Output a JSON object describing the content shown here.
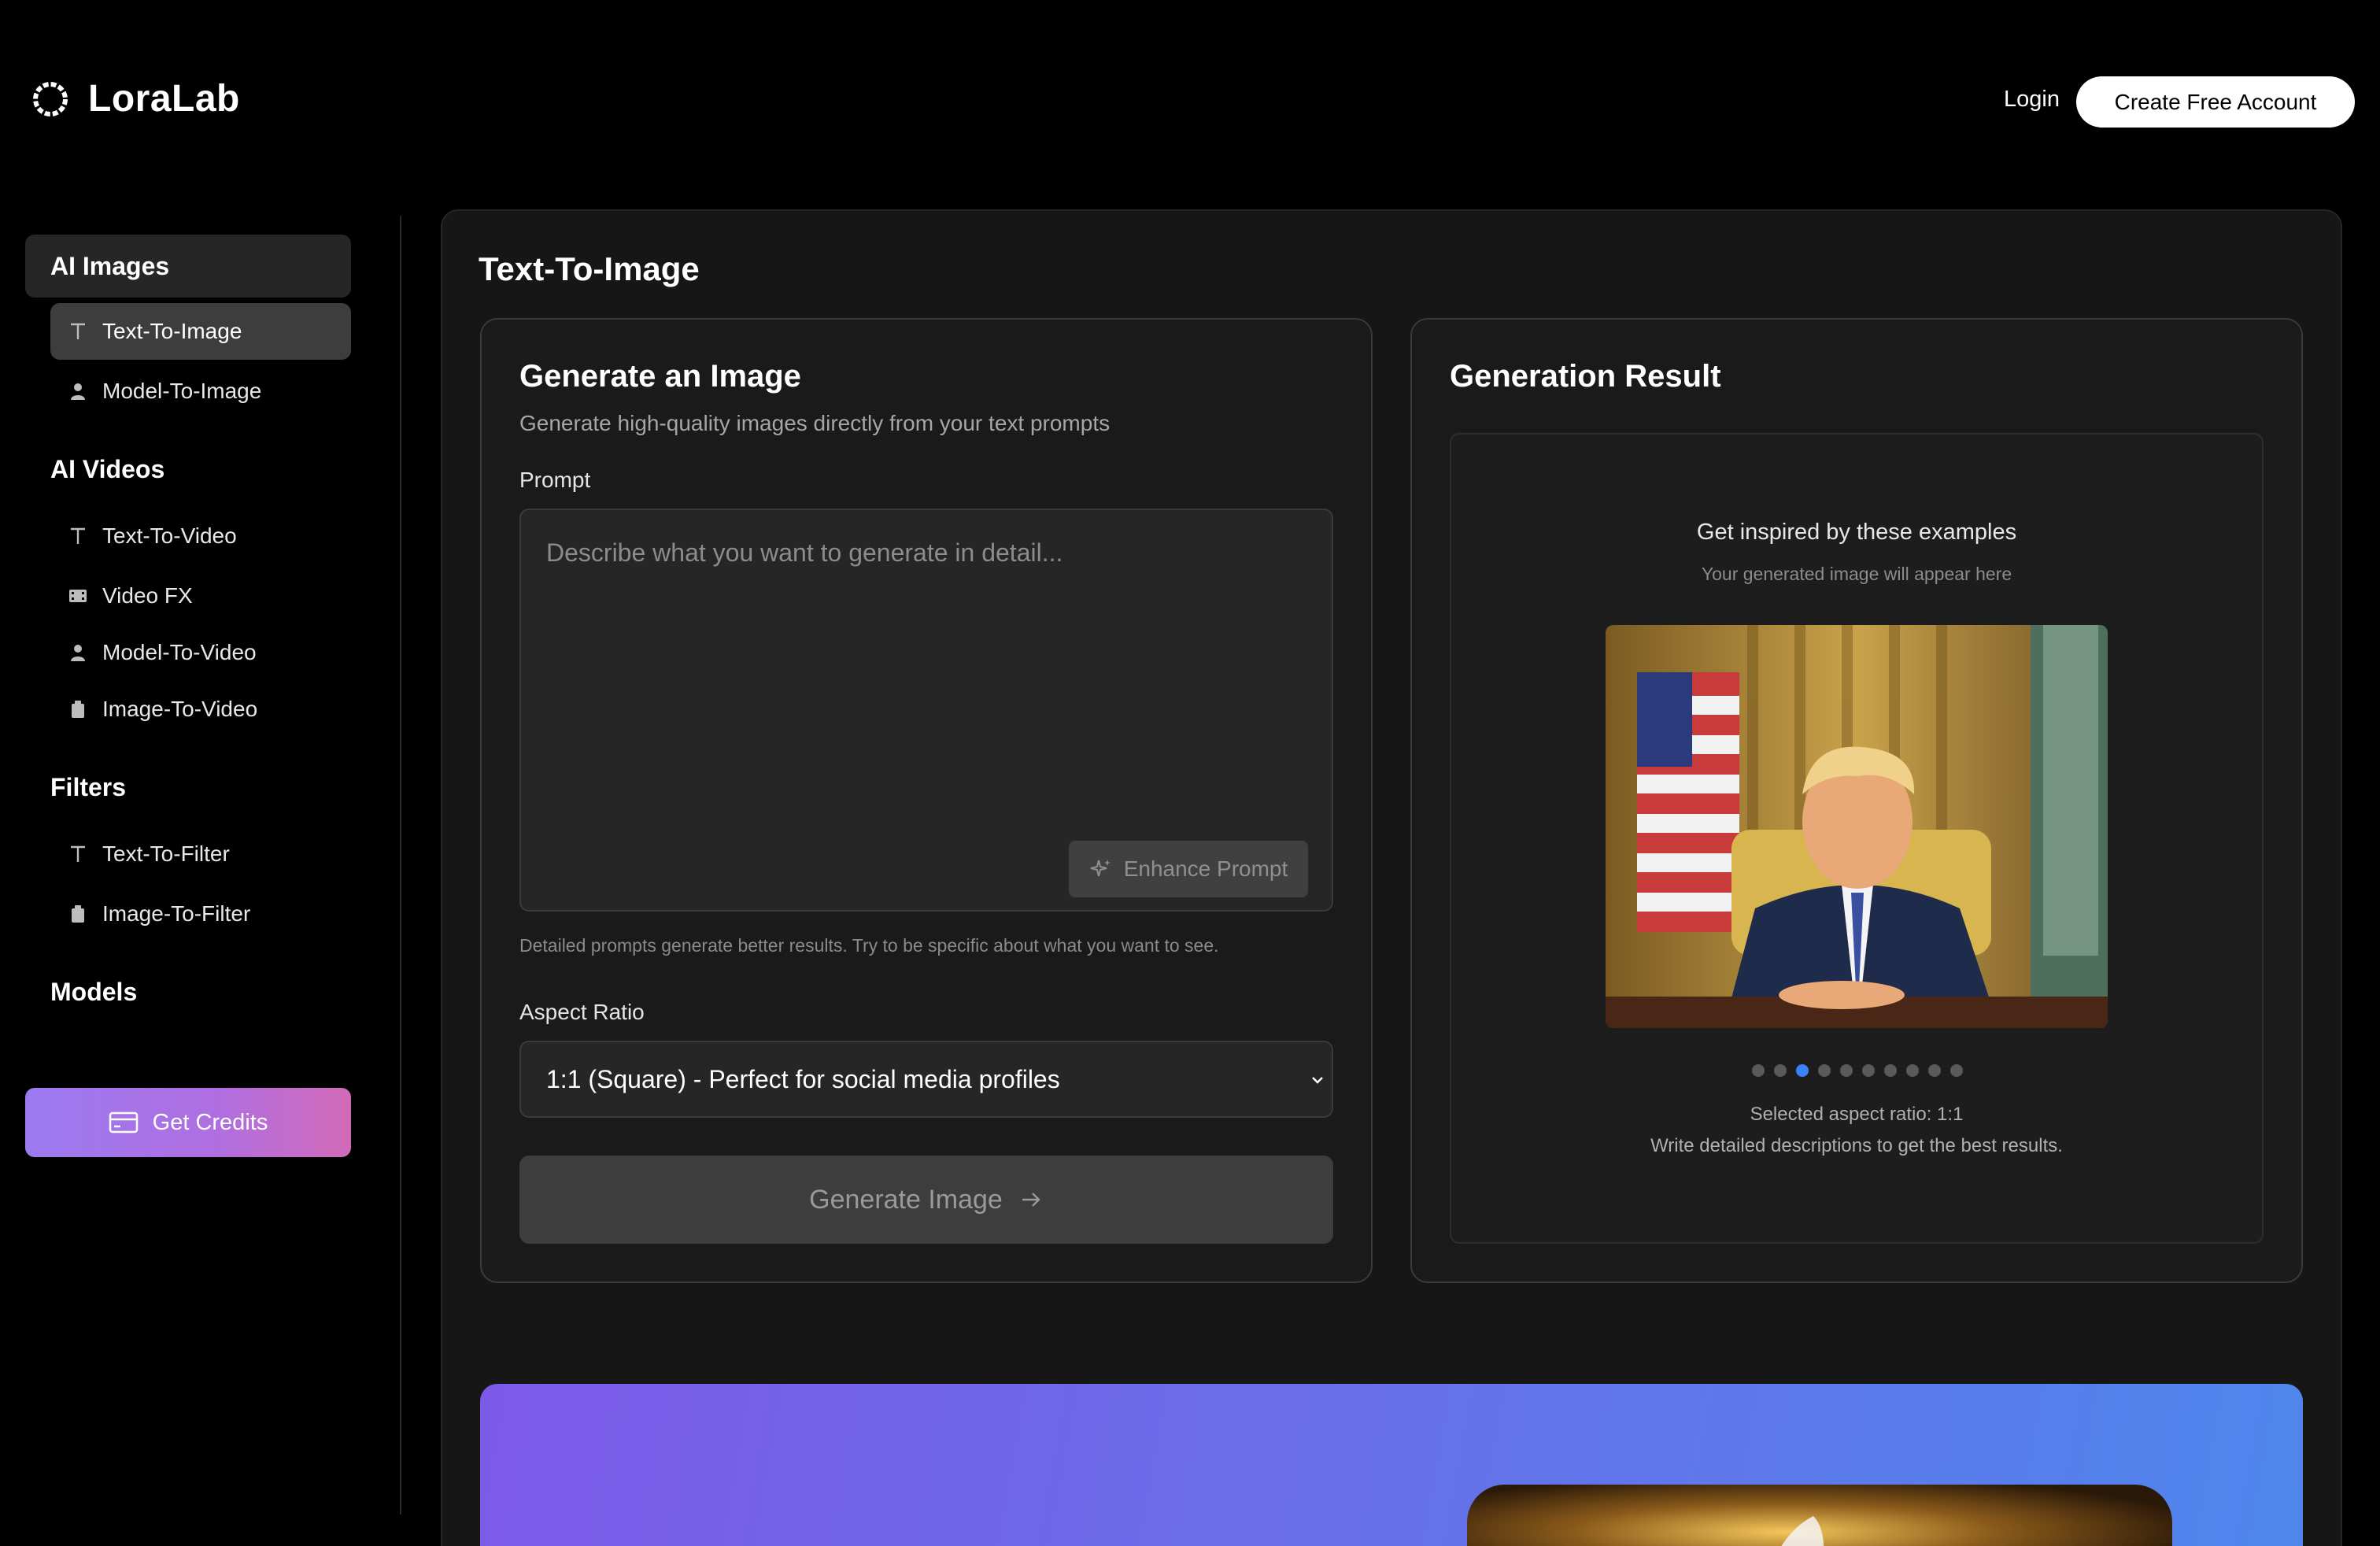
{
  "header": {
    "logo_text": "LoraLab",
    "login_label": "Login",
    "create_account_label": "Create Free Account"
  },
  "sidebar": {
    "sections": [
      {
        "title": "AI Images",
        "active": true,
        "items": [
          {
            "label": "Text-To-Image",
            "icon": "text-icon",
            "active": true
          },
          {
            "label": "Model-To-Image",
            "icon": "person-icon",
            "active": false
          }
        ]
      },
      {
        "title": "AI Videos",
        "items": [
          {
            "label": "Text-To-Video",
            "icon": "text-icon"
          },
          {
            "label": "Video FX",
            "icon": "film-icon"
          },
          {
            "label": "Model-To-Video",
            "icon": "person-icon"
          },
          {
            "label": "Image-To-Video",
            "icon": "image-icon"
          }
        ]
      },
      {
        "title": "Filters",
        "items": [
          {
            "label": "Text-To-Filter",
            "icon": "text-icon"
          },
          {
            "label": "Image-To-Filter",
            "icon": "image-icon"
          }
        ]
      },
      {
        "title": "Models",
        "items": []
      }
    ],
    "get_credits_label": "Get Credits",
    "get_credits_icon": "credit-card-icon"
  },
  "main": {
    "page_title": "Text-To-Image",
    "generate_card": {
      "title": "Generate an Image",
      "subtitle": "Generate high-quality images directly from your text prompts",
      "prompt_label": "Prompt",
      "prompt_placeholder": "Describe what you want to generate in detail...",
      "enhance_label": "Enhance Prompt",
      "helper_text": "Detailed prompts generate better results. Try to be specific about what you want to see.",
      "aspect_label": "Aspect Ratio",
      "aspect_value": "1:1 (Square) - Perfect for social media profiles",
      "generate_label": "Generate Image"
    },
    "result_card": {
      "title": "Generation Result",
      "inspire_title": "Get inspired by these examples",
      "inspire_subtitle": "Your generated image will appear here",
      "carousel_count": 10,
      "carousel_active_index": 2,
      "note_aspect": "Selected aspect ratio: 1:1",
      "note_tip": "Write detailed descriptions to get the best results."
    }
  },
  "colors": {
    "background": "#000000",
    "panel": "#161616",
    "card": "#1a1a1a",
    "border": "#3a3a3a",
    "accent_blue": "#3b82f6",
    "credits_gradient_start": "#9b7af0",
    "credits_gradient_end": "#d36ab8",
    "banner_gradient_start": "#7c5ae8",
    "banner_gradient_end": "#4f86ec"
  }
}
